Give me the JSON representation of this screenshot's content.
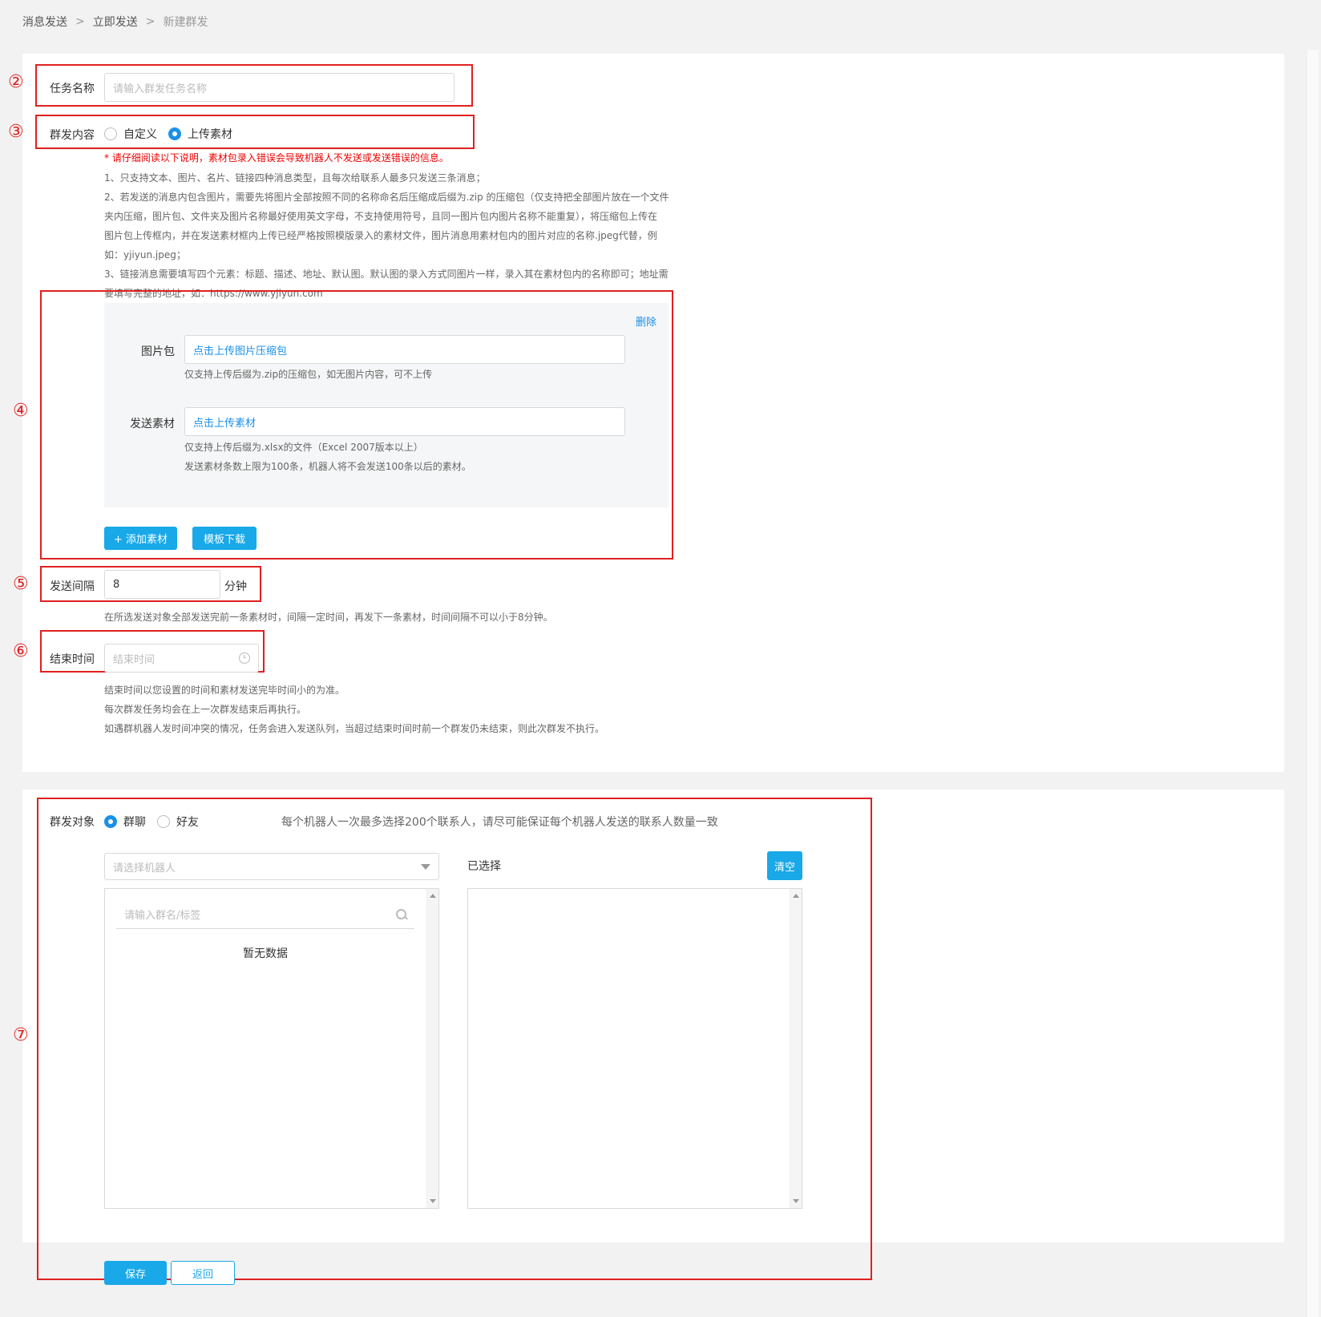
{
  "breadcrumb": {
    "items": [
      "消息发送",
      "立即发送",
      "新建群发"
    ],
    "sep": ">"
  },
  "task": {
    "label": "任务名称",
    "placeholder": "请输入群发任务名称"
  },
  "content": {
    "label": "群发内容",
    "options": [
      "自定义",
      "上传素材"
    ],
    "selected": "上传素材"
  },
  "notice": {
    "warning": "* 请仔细阅读以下说明，素材包录入错误会导致机器人不发送或发送错误的信息。",
    "lines": [
      "1、只支持文本、图片、名片、链接四种消息类型，且每次给联系人最多只发送三条消息；",
      "2、若发送的消息内包含图片，需要先将图片全部按照不同的名称命名后压缩成后缀为.zip 的压缩包（仅支持把全部图片放在一个文件",
      "夹内压缩，图片包、文件夹及图片名称最好使用英文字母，不支持使用符号，且同一图片包内图片名称不能重复），将压缩包上传在",
      "图片包上传框内，并在发送素材框内上传已经严格按照模版录入的素材文件，图片消息用素材包内的图片对应的名称.jpeg代替，例",
      "如：yjiyun.jpeg；",
      "3、链接消息需要填写四个元素：标题、描述、地址、默认图。默认图的录入方式同图片一样，录入其在素材包内的名称即可；地址需",
      "要填写完整的地址，如：https://www.yjiyun.com"
    ]
  },
  "material": {
    "delete_label": "删除",
    "image_pack": {
      "label": "图片包",
      "value": "点击上传图片压缩包",
      "hint": "仅支持上传后缀为.zip的压缩包，如无图片内容，可不上传"
    },
    "send_material": {
      "label": "发送素材",
      "value": "点击上传素材",
      "hint1": "仅支持上传后缀为.xlsx的文件（Excel 2007版本以上）",
      "hint2": "发送素材条数上限为100条，机器人将不会发送100条以后的素材。"
    },
    "add_button": "+ 添加素材",
    "template_button": "模板下载"
  },
  "interval": {
    "label": "发送间隔",
    "value": "8",
    "unit": "分钟",
    "hint": "在所选发送对象全部发送完前一条素材时，间隔一定时间，再发下一条素材，时间间隔不可以小于8分钟。"
  },
  "endtime": {
    "label": "结束时间",
    "placeholder": "结束时间",
    "hints": [
      "结束时间以您设置的时间和素材发送完毕时间小的为准。",
      "每次群发任务均会在上一次群发结束后再执行。",
      "如遇群机器人发时间冲突的情况，任务会进入发送队列，当超过结束时间时前一个群发仍未结束，则此次群发不执行。"
    ]
  },
  "target": {
    "label": "群发对象",
    "options": [
      "群聊",
      "好友"
    ],
    "selected": "群聊",
    "hint": "每个机器人一次最多选择200个联系人，请尽可能保证每个机器人发送的联系人数量一致",
    "robot_placeholder": "请选择机器人",
    "search_placeholder": "请输入群名/标签",
    "empty": "暂无数据",
    "selected_label": "已选择",
    "clear_button": "清空"
  },
  "footer": {
    "save": "保存",
    "back": "返回"
  },
  "annotations": [
    "②",
    "③",
    "④",
    "⑤",
    "⑥",
    "⑦"
  ]
}
